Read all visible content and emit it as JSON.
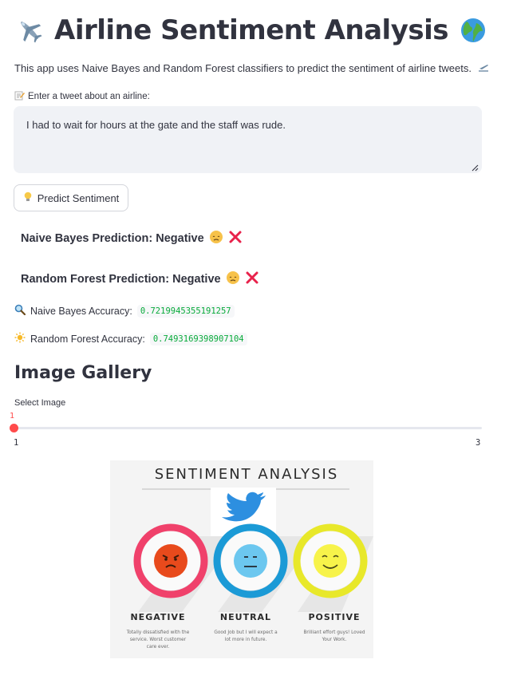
{
  "header": {
    "title": "Airline Sentiment Analysis",
    "left_icon": "airplane-icon",
    "right_icon": "globe-icon"
  },
  "description": "This app uses Naive Bayes and Random Forest classifiers to predict the sentiment of airline tweets.",
  "input": {
    "label": "Enter a tweet about an airline:",
    "value": "I had to wait for hours at the gate and the staff was rude."
  },
  "button": {
    "label": "Predict Sentiment",
    "icon": "lightbulb-icon"
  },
  "predictions": {
    "naive_bayes": "Naive Bayes Prediction: Negative",
    "random_forest": "Random Forest Prediction: Negative"
  },
  "accuracy": {
    "naive_bayes_label": "Naive Bayes Accuracy:",
    "naive_bayes_value": "0.7219945355191257",
    "random_forest_label": "Random Forest Accuracy:",
    "random_forest_value": "0.7493169398907104"
  },
  "gallery": {
    "title": "Image Gallery",
    "slider_label": "Select Image",
    "slider_value": "1",
    "slider_min": "1",
    "slider_max": "3"
  },
  "image": {
    "heading": "SENTIMENT ANALYSIS",
    "negative_label": "NEGATIVE",
    "negative_line1": "Totally dissatisfied with the",
    "negative_line2": "service. Worst customer",
    "negative_line3": "care ever.",
    "neutral_label": "NEUTRAL",
    "neutral_line1": "Good Job but I will expect a",
    "neutral_line2": "lot more in future.",
    "positive_label": "POSITIVE",
    "positive_line1": "Brilliant effort guys! Loved",
    "positive_line2": "Your Work.",
    "colors": {
      "negative": "#f0416b",
      "neutral": "#1b9ad6",
      "positive": "#e8e82a"
    }
  },
  "colors": {
    "accent": "#ff4b4b",
    "code_text": "#09ab3b",
    "cross": "#e8224b"
  }
}
